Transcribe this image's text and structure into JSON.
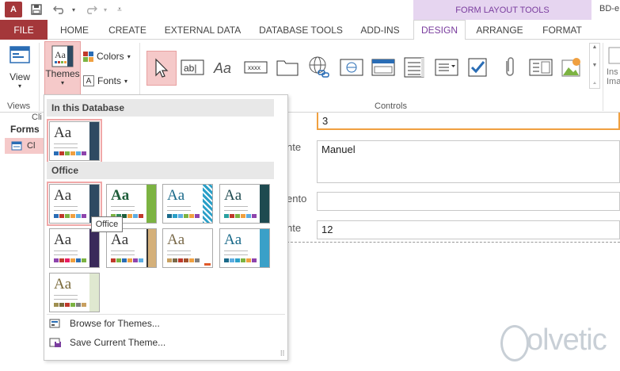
{
  "titlebar": {
    "app_icon": "access-logo",
    "app_icon_text": "A",
    "contextual_tab_title": "FORM LAYOUT TOOLS",
    "document_title": "BD-e"
  },
  "tabs": [
    "FILE",
    "HOME",
    "CREATE",
    "EXTERNAL DATA",
    "DATABASE TOOLS",
    "ADD-INS",
    "DESIGN",
    "ARRANGE",
    "FORMAT"
  ],
  "ribbon": {
    "views": {
      "button_label": "View",
      "group_label": "Views"
    },
    "themes": {
      "button_label": "Themes",
      "colors_label": "Colors",
      "fonts_label": "Fonts"
    },
    "controls": {
      "group_label": "Controls",
      "insert_image_label": "Ins",
      "insert_image_label2": "Ima"
    }
  },
  "navpane": {
    "top_item": "Cli",
    "group_label": "Forms",
    "item_label": "Cl"
  },
  "form": {
    "fields": [
      {
        "label": "",
        "value": "3"
      },
      {
        "label": "nte",
        "value": "Manuel"
      },
      {
        "label": "ento",
        "value": ""
      },
      {
        "label": "nte",
        "value": "12"
      }
    ]
  },
  "themes_dropdown": {
    "section_db": "In this Database",
    "section_office": "Office",
    "tooltip": "Office",
    "browse_label": "Browse for Themes...",
    "save_label": "Save Current Theme..."
  },
  "watermark": "olvetic"
}
